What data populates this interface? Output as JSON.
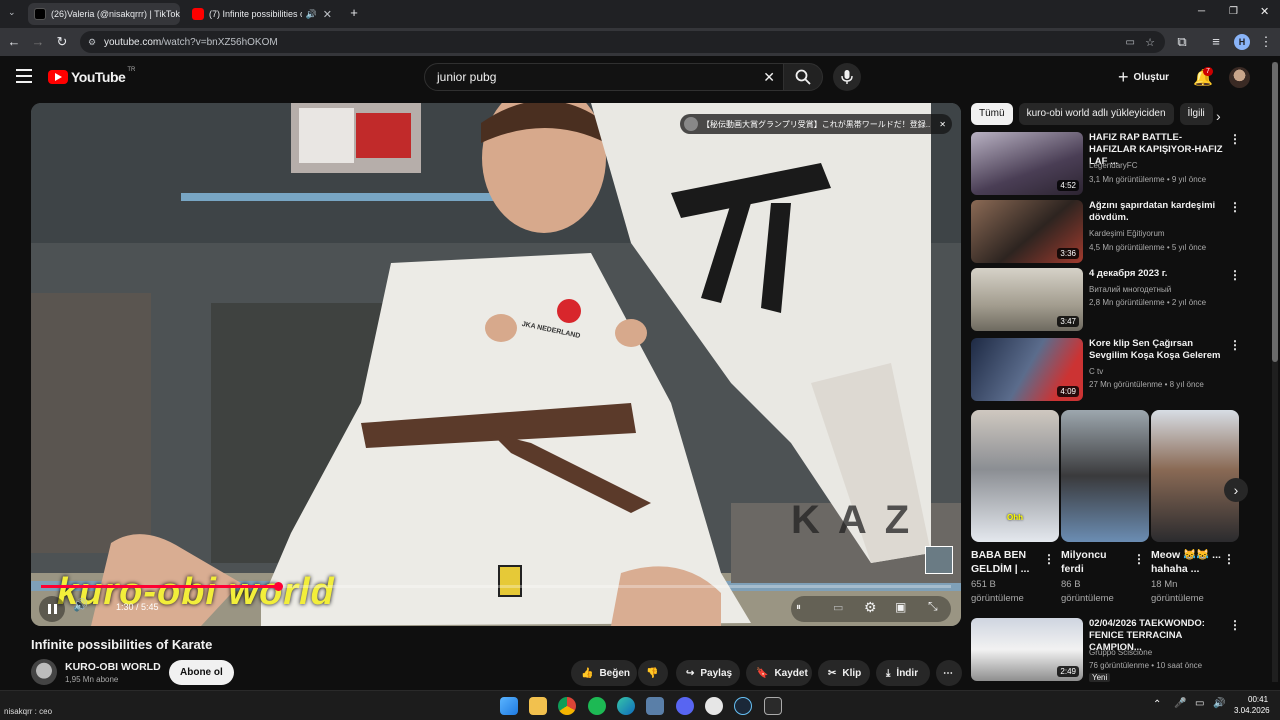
{
  "browser": {
    "tabs": [
      {
        "title": "(26)Valeria (@nisakqrrr) | TikTok",
        "close": "✕"
      },
      {
        "title": "(7) Infinite possibilities of Ka",
        "close": "✕"
      }
    ],
    "url_host": "youtube.com",
    "url_path": "/watch?v=bnXZ56hOKOM",
    "new_tab": "+"
  },
  "youtube": {
    "logo": "YouTube",
    "country": "TR",
    "search_value": "junior pubg",
    "create_label": "Oluştur",
    "notif_count": "7",
    "profile_initial": "H"
  },
  "player": {
    "overlay_banner": "【秘伝動画大賞グランプリ受賞】これが黒帯ワールドだ！登録...",
    "watermark": "kuro-obi world",
    "time": "1:30 / 5:45",
    "progress": 0.26,
    "gi_patch": "JKA NEDERLAND",
    "bg_sign": "KAZ"
  },
  "video": {
    "title": "Infinite possibilities of Karate",
    "channel": "KURO-OBI WORLD",
    "subs": "1,95 Mn abone",
    "subscribe": "Abone ol",
    "actions": {
      "like": "Beğen",
      "share": "Paylaş",
      "save": "Kaydet",
      "clip": "Klip",
      "download": "İndir"
    }
  },
  "chips": [
    "Tümü",
    "kuro-obi world adlı yükleyiciden",
    "İlgili"
  ],
  "recs": [
    {
      "title": "HAFIZ RAP BATTLE-HAFIZLAR KAPIŞIYOR-HAFIZ LAF ...",
      "channel": "LegendaryFC",
      "meta": "3,1 Mn görüntülenme • 9 yıl önce",
      "dur": "4:52"
    },
    {
      "title": "Ağzını şapırdatan kardeşimi dövdüm.",
      "channel": "Kardeşimi Eğitiyorum",
      "meta": "4,5 Mn görüntülenme • 5 yıl önce",
      "dur": "3:36"
    },
    {
      "title": "4 декабря 2023 г.",
      "channel": "Виталий многодетный",
      "meta": "2,8 Mn görüntülenme • 2 yıl önce",
      "dur": "3:47"
    },
    {
      "title": "Kore klip Sen Çağırsan Sevgilim Koşa Koşa Gelerem",
      "channel": "C tv",
      "meta": "27 Mn görüntülenme • 8 yıl önce",
      "dur": "4:09"
    }
  ],
  "shorts": [
    {
      "title": "BABA BEN GELDİM | ...",
      "views": "651 B görüntüleme",
      "caption": "Ohh"
    },
    {
      "title": "Milyoncu ferdi",
      "views": "86 B görüntüleme"
    },
    {
      "title": "Meow 😹😹 ... hahaha ...",
      "views": "18 Mn görüntüleme"
    }
  ],
  "rec_last": {
    "title": "02/04/2026 TAEKWONDO: FENICE TERRACINA CAMPION...",
    "channel": "Gruppo Sciscione",
    "meta": "76 görüntülenme • 10 saat önce",
    "badge": "Yeni",
    "dur": "2:49"
  },
  "status": {
    "left": "nisakqrr : ceo"
  },
  "taskbar": {
    "time": "00:41",
    "date": "3.04.2026"
  },
  "colors": {
    "yt_red": "#ff0000",
    "progress": "#f03",
    "watermark": "#f2ee3a"
  }
}
